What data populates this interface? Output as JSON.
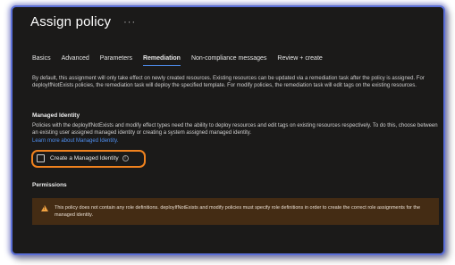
{
  "header": {
    "title": "Assign policy",
    "more_icon": "ellipsis-icon",
    "more_glyph": "···"
  },
  "tabs": [
    {
      "label": "Basics",
      "active": false
    },
    {
      "label": "Advanced",
      "active": false
    },
    {
      "label": "Parameters",
      "active": false
    },
    {
      "label": "Remediation",
      "active": true
    },
    {
      "label": "Non-compliance messages",
      "active": false
    },
    {
      "label": "Review + create",
      "active": false
    }
  ],
  "remediation": {
    "description": "By default, this assignment will only take effect on newly created resources. Existing resources can be updated via a remediation task after the policy is assigned. For deployIfNotExists policies, the remediation task will deploy the specified template. For modify policies, the remediation task will edit tags on the existing resources."
  },
  "managed_identity": {
    "title": "Managed Identity",
    "description": "Policies with the deployIfNotExists and modify effect types need the ability to deploy resources and edit tags on existing resources respectively. To do this, choose between an existing user assigned managed identity or creating a system assigned managed identity.",
    "learn_more": "Learn more about Managed Identity.",
    "checkbox_label": "Create a Managed Identity",
    "checkbox_checked": false,
    "info_icon": "info-icon",
    "info_glyph": "i"
  },
  "permissions": {
    "title": "Permissions",
    "warning_icon": "warning-icon",
    "warning_text": "This policy does not contain any role definitions. deployIfNotExists and modify policies must specify role definitions in order to create the correct role assignments for the managed identity."
  },
  "colors": {
    "background": "#1b1a19",
    "accent": "#4f8ff0",
    "highlight": "#f0821e",
    "warning_bg": "#442c14",
    "warning_icon": "#f2a341",
    "frame_border": "#5b6fd6"
  }
}
